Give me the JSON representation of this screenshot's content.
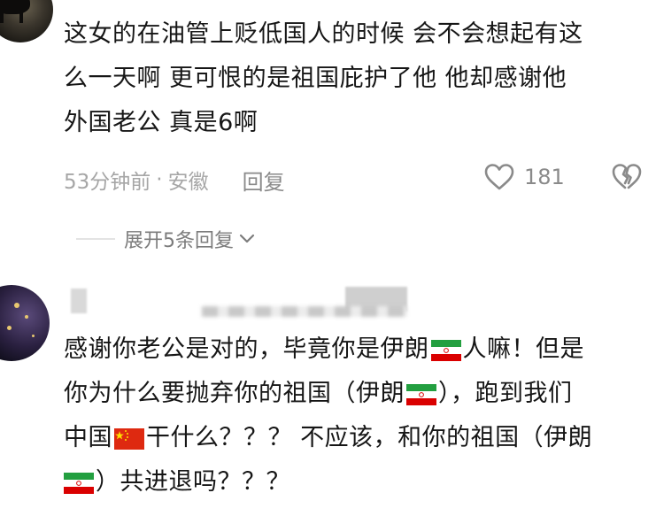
{
  "comment1": {
    "lines": [
      "这女的在油管上贬低国人的时候 会不会想起有这",
      "么一天啊 更可恨的是祖国庇护了他 他却感谢他",
      "外国老公 真是6啊"
    ],
    "time": "53分钟前",
    "separator": "·",
    "location": "安徽",
    "reply_label": "回复",
    "like_count": "181",
    "expand_label": "展开5条回复"
  },
  "comment2": {
    "line1_a": "感谢你老公是对的，毕竟你是伊朗",
    "line1_b": "人嘛！但是",
    "line2_a": "你为什么要抛弃你的祖国（伊朗",
    "line2_b": "），跑到我们",
    "line3_a": "中国",
    "line3_b": "干什么？？？ 不应该，和你的祖国（伊朗",
    "line4_b": "）共进退吗？？？"
  },
  "colors": {
    "text": "#161616",
    "meta": "#a6a6a6",
    "icon": "#8a8a8a",
    "iran_green": "#239f40",
    "iran_red": "#da0000",
    "china_red": "#de2910",
    "china_yellow": "#ffde00"
  },
  "icons": {
    "like": "heart-outline-icon",
    "dislike": "broken-heart-icon",
    "expand": "chevron-down-icon"
  }
}
